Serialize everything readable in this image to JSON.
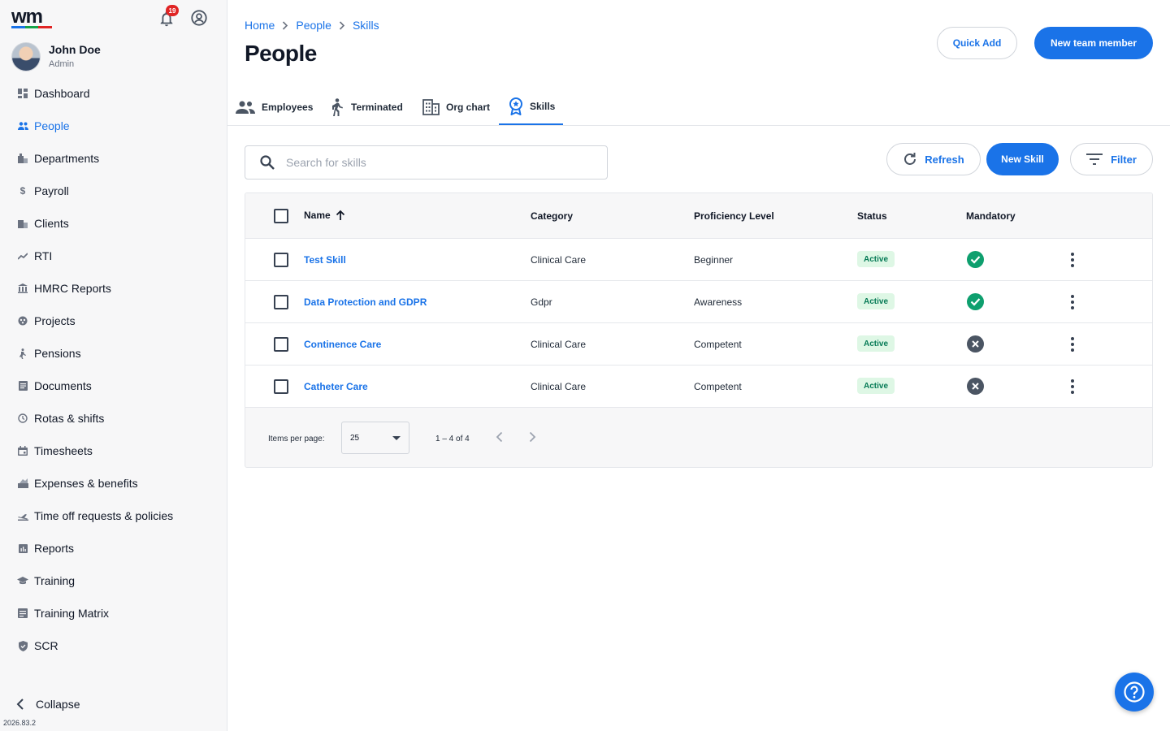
{
  "app": {
    "notifications_count": "19",
    "version": "2026.83.2"
  },
  "user": {
    "name": "John Doe",
    "role": "Admin"
  },
  "sidebar": {
    "items": [
      {
        "label": "Dashboard",
        "icon": "dashboard-icon"
      },
      {
        "label": "People",
        "icon": "people-icon",
        "active": true
      },
      {
        "label": "Departments",
        "icon": "building-icon"
      },
      {
        "label": "Payroll",
        "icon": "dollar-icon"
      },
      {
        "label": "Clients",
        "icon": "clients-icon"
      },
      {
        "label": "RTI",
        "icon": "trend-icon"
      },
      {
        "label": "HMRC Reports",
        "icon": "bank-icon"
      },
      {
        "label": "Projects",
        "icon": "projects-icon"
      },
      {
        "label": "Pensions",
        "icon": "pensions-icon"
      },
      {
        "label": "Documents",
        "icon": "document-icon"
      },
      {
        "label": "Rotas & shifts",
        "icon": "clock-icon"
      },
      {
        "label": "Timesheets",
        "icon": "calendar-icon"
      },
      {
        "label": "Expenses & benefits",
        "icon": "expenses-icon"
      },
      {
        "label": "Time off requests & policies",
        "icon": "plane-icon"
      },
      {
        "label": "Reports",
        "icon": "reports-icon"
      },
      {
        "label": "Training",
        "icon": "graduation-cap-icon"
      },
      {
        "label": "Training Matrix",
        "icon": "matrix-icon"
      },
      {
        "label": "SCR",
        "icon": "shield-icon"
      }
    ],
    "collapse_label": "Collapse"
  },
  "header": {
    "breadcrumb": [
      "Home",
      "People",
      "Skills"
    ],
    "title": "People",
    "quick_add_label": "Quick Add",
    "new_member_label": "New team member"
  },
  "tabs": [
    {
      "label": "Employees",
      "icon": "people-icon"
    },
    {
      "label": "Terminated",
      "icon": "walking-icon"
    },
    {
      "label": "Org chart",
      "icon": "org-chart-icon"
    },
    {
      "label": "Skills",
      "icon": "badge-icon",
      "active": true
    }
  ],
  "toolbar": {
    "search_placeholder": "Search for skills",
    "refresh_label": "Refresh",
    "new_skill_label": "New Skill",
    "filter_label": "Filter"
  },
  "table": {
    "columns": [
      "Name",
      "Category",
      "Proficiency Level",
      "Status",
      "Mandatory"
    ],
    "rows": [
      {
        "name": "Test Skill",
        "category": "Clinical Care",
        "level": "Beginner",
        "status": "Active",
        "mandatory": true
      },
      {
        "name": "Data Protection and GDPR",
        "category": "Gdpr",
        "level": "Awareness",
        "status": "Active",
        "mandatory": true
      },
      {
        "name": "Continence Care",
        "category": "Clinical Care",
        "level": "Competent",
        "status": "Active",
        "mandatory": false
      },
      {
        "name": "Catheter Care",
        "category": "Clinical Care",
        "level": "Competent",
        "status": "Active",
        "mandatory": false
      }
    ]
  },
  "pagination": {
    "items_per_page_label": "Items per page:",
    "items_per_page": "25",
    "range": "1 – 4 of 4"
  },
  "colors": {
    "accent": "#1a73e8",
    "success": "#0e9f6e",
    "neutral_icon": "#4b5563",
    "badge": "#e02424"
  }
}
